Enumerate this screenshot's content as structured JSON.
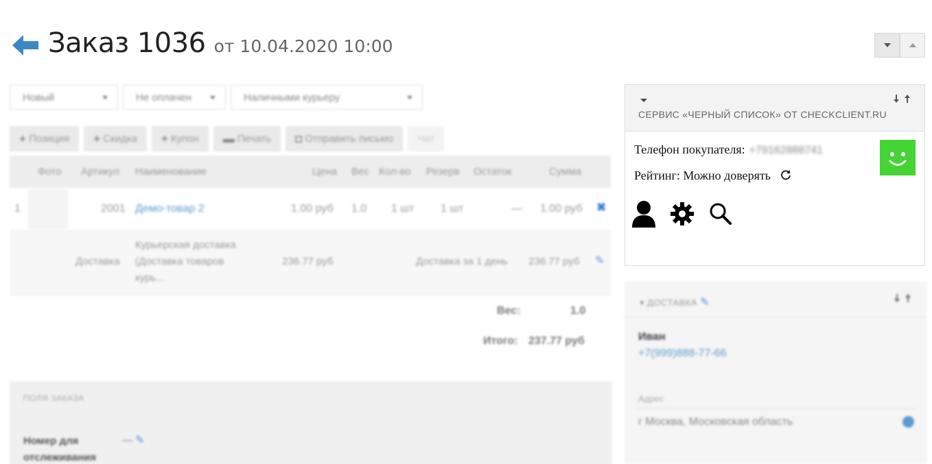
{
  "header": {
    "title": "Заказ 1036",
    "date": "от 10.04.2020 10:00"
  },
  "order": {
    "status_select": "Новый",
    "payment_select": "Не оплачен",
    "payment_method_select": "Наличными курьеру",
    "toolbar": [
      "Позиция",
      "Скидка",
      "Купон",
      "Печать",
      "Отправить письмо",
      "Чат"
    ],
    "columns": [
      "Фото",
      "Артикул",
      "Наименование",
      "Цена",
      "Вес",
      "Кол-во",
      "Резерв",
      "Остаток",
      "Сумма"
    ],
    "item": {
      "num": "1",
      "article": "2001",
      "name": "Демо-товар 2",
      "price": "1.00 руб",
      "weight": "1.0",
      "qty": "1 шт",
      "reserve": "1 шт",
      "stock": "—",
      "sum": "1.00 руб"
    },
    "delivery_row": {
      "label": "Доставка",
      "name_line1": "Курьерская доставка",
      "name_line2": "(Доставка товаров",
      "name_line3": "курь...",
      "price": "236.77 руб",
      "term": "Доставка за 1 день",
      "sum": "236.77 руб"
    },
    "totals": {
      "weight_label": "Вес:",
      "weight_value": "1.0",
      "total_label": "Итого:",
      "total_value": "237.77 руб"
    },
    "fields_panel": {
      "title": "ПОЛЯ ЗАКАЗА",
      "tracking_label": "Номер для отслеживания",
      "tracking_value": "—"
    }
  },
  "blacklist": {
    "title": "СЕРВИС «ЧЕРНЫЙ СПИСОК» ОТ CHECKCLIENT.RU",
    "arrows": "🡓🡑",
    "phone_label": "Телефон покупателя:",
    "phone_value": "+79162888741",
    "rating_label": "Рейтинг: Можно доверять",
    "smile_color": "#44d434"
  },
  "delivery": {
    "title": "ДОСТАВКА",
    "name": "Иван",
    "phone": "+7(999)888-77-66",
    "address_label": "Адрес",
    "address": "г Москва, Московская область"
  }
}
